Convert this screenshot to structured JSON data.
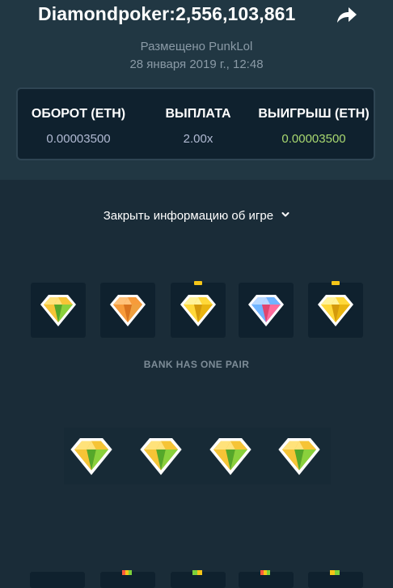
{
  "header": {
    "title": "Diamondpoker:2,556,103,861",
    "posted_by": "Размещено PunkLol",
    "date": "28 января 2019 г., 12:48"
  },
  "stats": [
    {
      "label": "ОБОРОТ (ETH)",
      "value": "0.00003500"
    },
    {
      "label": "ВЫПЛАТА",
      "value": "2.00x"
    },
    {
      "label": "ВЫИГРЫШ (ETH)",
      "value": "0.00003500"
    }
  ],
  "toggle_label": "Закрыть информацию об игре",
  "bank": {
    "label": "BANK HAS ONE PAIR",
    "gems": [
      "yellow-green",
      "orange",
      "yellow",
      "multicolor",
      "yellow"
    ],
    "marked": [
      false,
      false,
      true,
      false,
      true
    ]
  },
  "player": {
    "gems": [
      "yellow-green",
      "yellow-green",
      "yellow-green",
      "yellow-green"
    ]
  },
  "colors": {
    "background": "#1a2c38",
    "header_bg": "#213743",
    "win_value": "#a8d870",
    "pair_marker": "#f5c518"
  }
}
